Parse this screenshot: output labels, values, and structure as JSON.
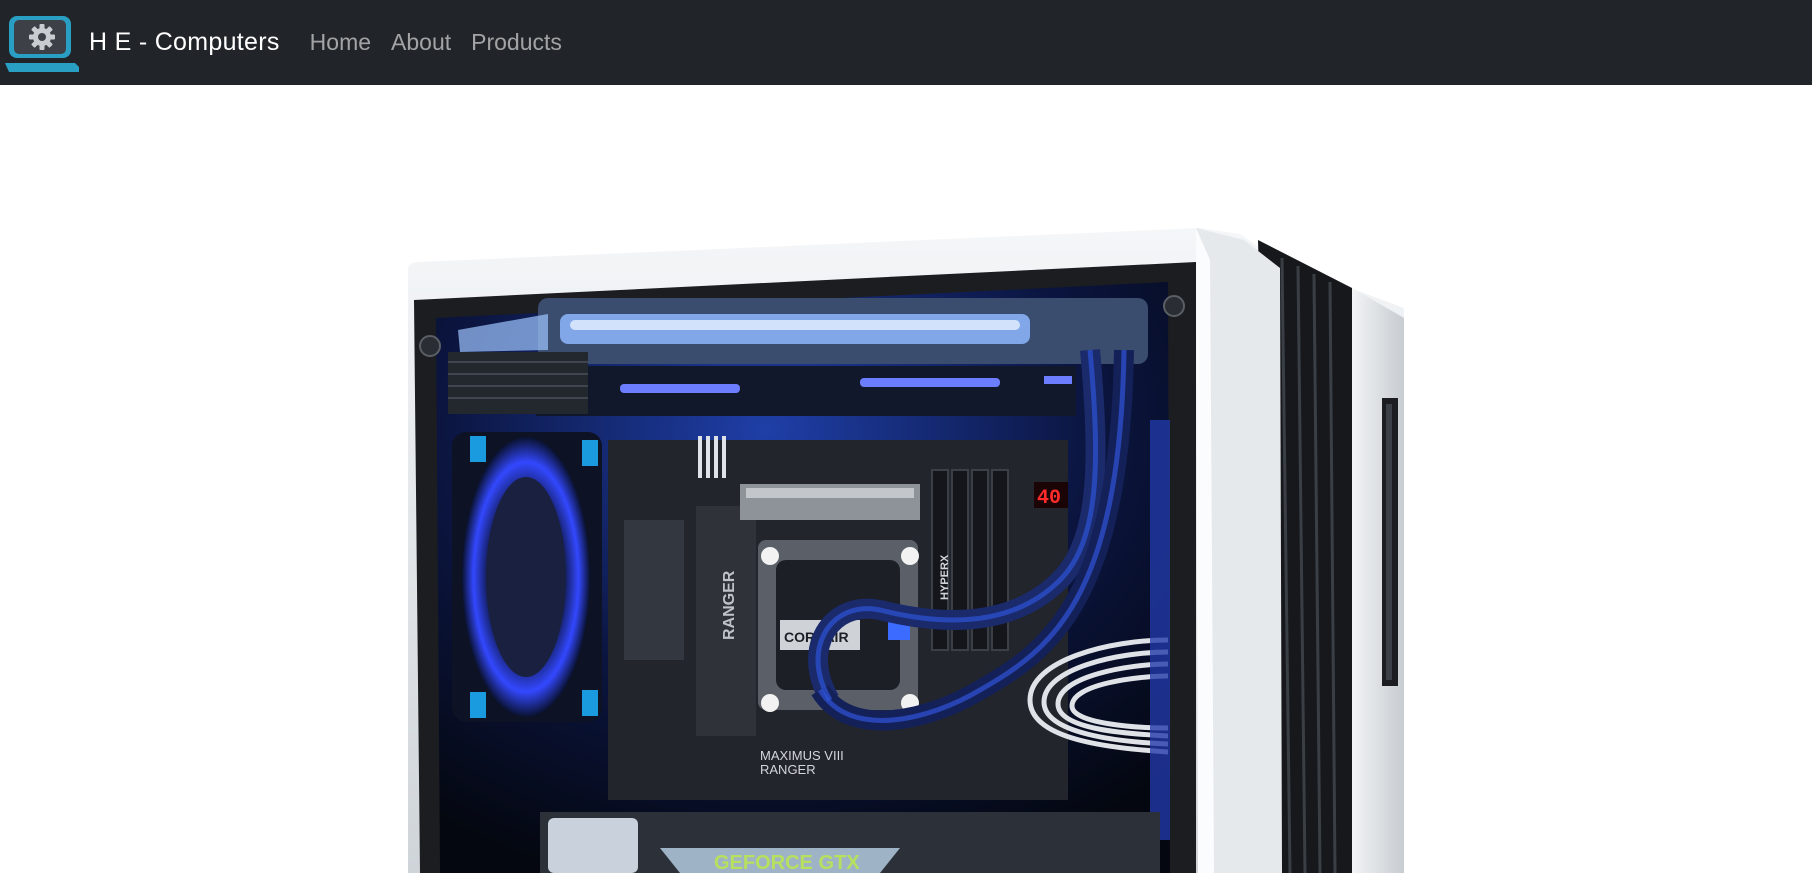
{
  "navbar": {
    "brand": {
      "text": "H E - Computers",
      "logo_icon": "laptop-gear-icon"
    },
    "links": [
      {
        "label": "Home"
      },
      {
        "label": "About"
      },
      {
        "label": "Products"
      }
    ]
  },
  "hero": {
    "image_subject": "gaming-pc-case-image",
    "printed_text": {
      "cooler_brand": "CORSAIR",
      "ram_brand": "HYPERX",
      "board_name_line1": "MAXIMUS VIII",
      "board_name_line2": "RANGER",
      "heatsink_label": "RANGER",
      "post_code": "40",
      "gpu_label": "GEFORCE GTX"
    }
  },
  "colors": {
    "navbar_bg": "#212529",
    "brand_text": "#ffffff",
    "nav_link": "#9a9da0",
    "logo_accent": "#2a9fc4",
    "led_blue": "#2f5cff"
  }
}
